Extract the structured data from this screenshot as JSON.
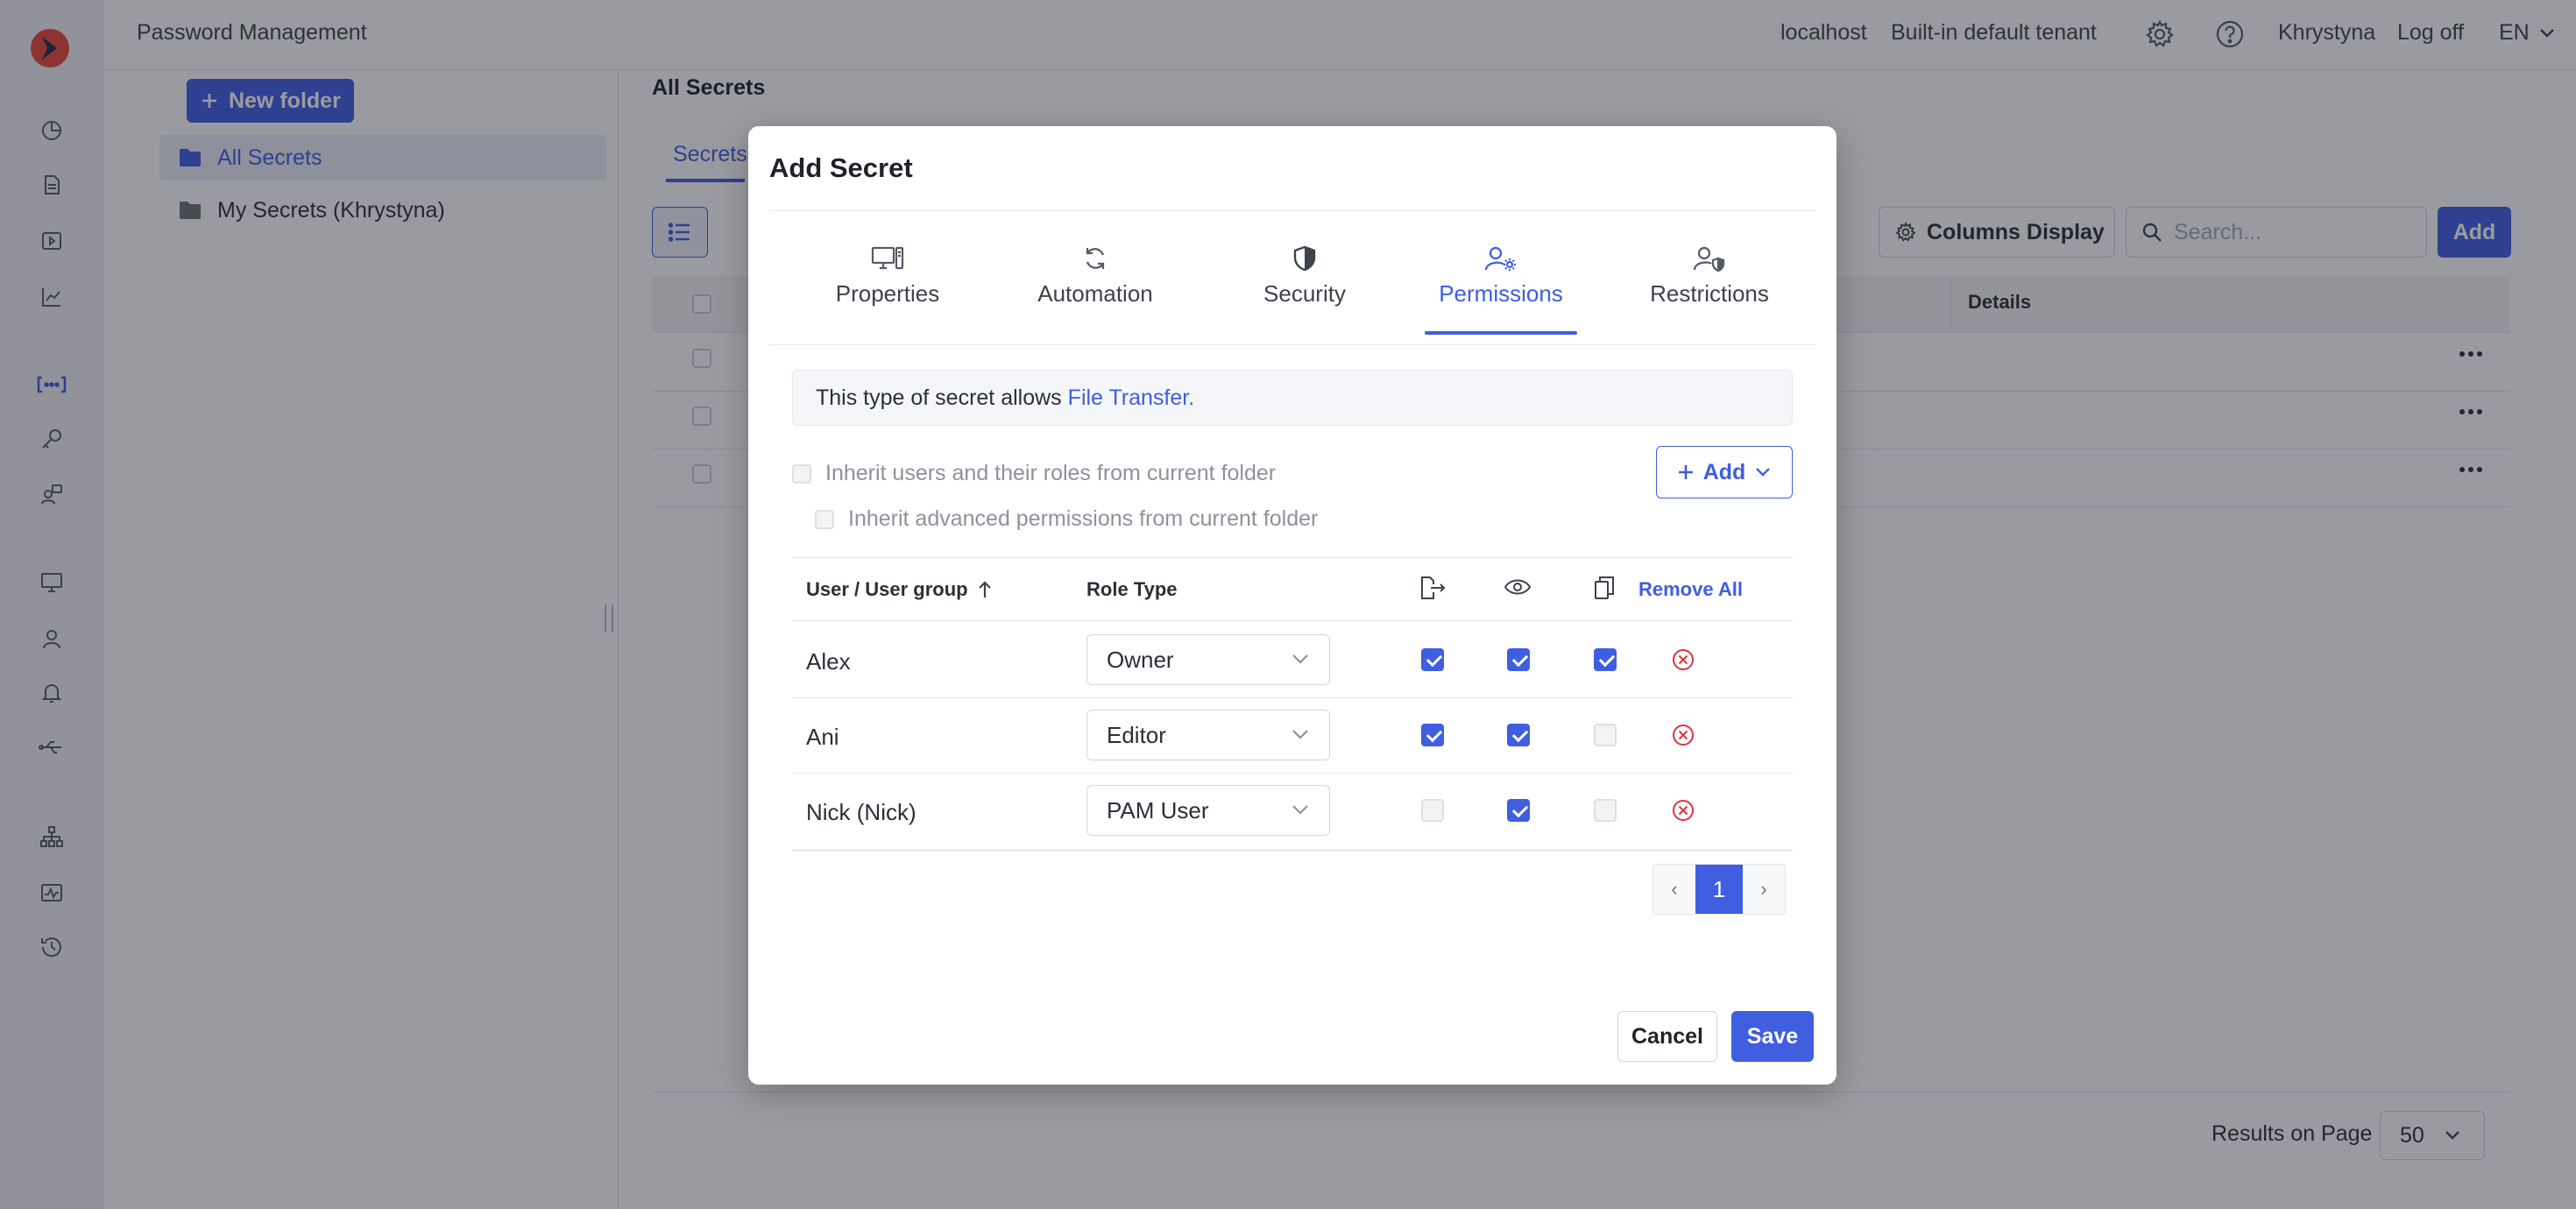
{
  "topbar": {
    "app_title": "Password Management",
    "host": "localhost",
    "tenant": "Built-in default tenant",
    "user": "Khrystyna",
    "logoff": "Log off",
    "language": "EN"
  },
  "folders": {
    "new_folder_label": "New folder",
    "items": [
      {
        "label": "All Secrets",
        "selected": true
      },
      {
        "label": "My Secrets (Khrystyna)",
        "selected": false
      }
    ]
  },
  "main": {
    "title": "All Secrets",
    "tab_label": "Secrets",
    "columns_display_label": "Columns Display",
    "search_placeholder": "Search...",
    "add_label": "Add",
    "details_header": "Details",
    "results_label": "Results on Page",
    "results_value": "50"
  },
  "modal": {
    "title": "Add Secret",
    "tabs": [
      {
        "label": "Properties",
        "icon": "monitor-icon",
        "active": false
      },
      {
        "label": "Automation",
        "icon": "refresh-icon",
        "active": false
      },
      {
        "label": "Security",
        "icon": "shield-icon",
        "active": false
      },
      {
        "label": "Permissions",
        "icon": "user-gear-icon",
        "active": true
      },
      {
        "label": "Restrictions",
        "icon": "user-shield-icon",
        "active": false
      }
    ],
    "info_text": "This type of secret allows",
    "info_link": "File Transfer.",
    "inherit_users_label": "Inherit users and their roles from current folder",
    "inherit_advanced_label": "Inherit advanced permissions from current folder",
    "add_label": "Add",
    "table": {
      "col_user": "User / User group",
      "col_role": "Role Type",
      "icon_cols": [
        "file-transfer-icon",
        "eye-icon",
        "copy-icon"
      ],
      "remove_all_label": "Remove All",
      "rows": [
        {
          "user": "Alex",
          "role": "Owner",
          "transfer": true,
          "view": true,
          "copy": true
        },
        {
          "user": "Ani",
          "role": "Editor",
          "transfer": true,
          "view": true,
          "copy": false
        },
        {
          "user": "Nick (Nick)",
          "role": "PAM User",
          "transfer": false,
          "view": true,
          "copy": false
        }
      ]
    },
    "pager": {
      "prev": "‹",
      "current": "1",
      "next": "›"
    },
    "cancel_label": "Cancel",
    "save_label": "Save"
  },
  "colors": {
    "accent": "#3f5ee0",
    "remove": "#e0313f"
  }
}
